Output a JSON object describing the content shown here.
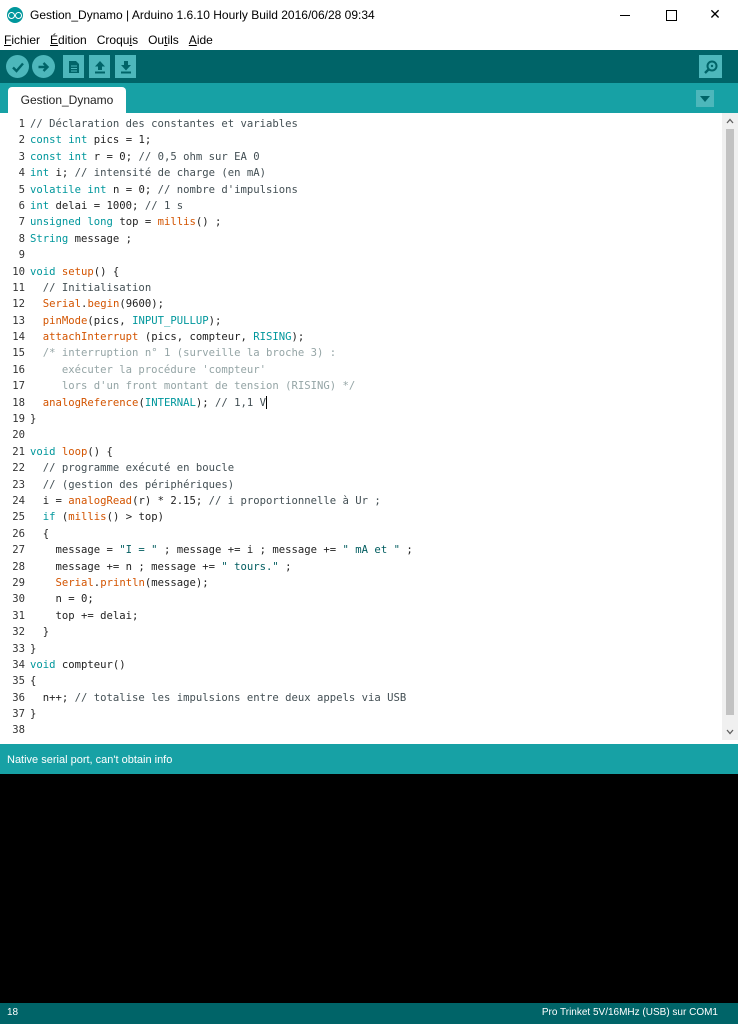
{
  "window": {
    "title": "Gestion_Dynamo | Arduino 1.6.10 Hourly Build 2016/06/28 09:34",
    "close_glyph": "✕"
  },
  "menu": {
    "items": [
      {
        "mnemonic": "F",
        "rest": "ichier"
      },
      {
        "mnemonic": "É",
        "rest": "dition"
      },
      {
        "prefix": "Croqu",
        "mnemonic": "i",
        "rest": "s"
      },
      {
        "prefix": "Ou",
        "mnemonic": "t",
        "rest": "ils"
      },
      {
        "mnemonic": "A",
        "rest": "ide"
      }
    ]
  },
  "toolbar": {
    "icons": [
      "verify-icon",
      "upload-icon",
      "new-sketch-icon",
      "open-sketch-icon",
      "save-sketch-icon",
      "serial-monitor-icon"
    ]
  },
  "tabs": [
    {
      "label": "Gestion_Dynamo"
    }
  ],
  "editor": {
    "line_numbers": [
      "1",
      "2",
      "3",
      "4",
      "5",
      "6",
      "7",
      "8",
      "9",
      "10",
      "11",
      "12",
      "13",
      "14",
      "15",
      "16",
      "17",
      "18",
      "19",
      "20",
      "21",
      "22",
      "23",
      "24",
      "25",
      "26",
      "27",
      "28",
      "29",
      "30",
      "31",
      "32",
      "33",
      "34",
      "35",
      "36",
      "37",
      "38"
    ],
    "lines": [
      [
        {
          "t": "// Déclaration des constantes et variables",
          "c": "cm"
        }
      ],
      [
        {
          "t": "const",
          "c": "kw"
        },
        {
          "t": " "
        },
        {
          "t": "int",
          "c": "kw"
        },
        {
          "t": " pics = 1;"
        }
      ],
      [
        {
          "t": "const",
          "c": "kw"
        },
        {
          "t": " "
        },
        {
          "t": "int",
          "c": "kw"
        },
        {
          "t": " r = 0; "
        },
        {
          "t": "// 0,5 ohm sur EA 0",
          "c": "cm"
        }
      ],
      [
        {
          "t": "int",
          "c": "kw"
        },
        {
          "t": " i; "
        },
        {
          "t": "// intensité de charge (en mA)",
          "c": "cm"
        }
      ],
      [
        {
          "t": "volatile",
          "c": "kw"
        },
        {
          "t": " "
        },
        {
          "t": "int",
          "c": "kw"
        },
        {
          "t": " n = 0; "
        },
        {
          "t": "// nombre d'impulsions",
          "c": "cm"
        }
      ],
      [
        {
          "t": "int",
          "c": "kw"
        },
        {
          "t": " delai = 1000; "
        },
        {
          "t": "// 1 s",
          "c": "cm"
        }
      ],
      [
        {
          "t": "unsigned",
          "c": "kw"
        },
        {
          "t": " "
        },
        {
          "t": "long",
          "c": "kw"
        },
        {
          "t": " top = "
        },
        {
          "t": "millis",
          "c": "fn"
        },
        {
          "t": "() ;"
        }
      ],
      [
        {
          "t": "String",
          "c": "kw"
        },
        {
          "t": " message ;"
        }
      ],
      [],
      [
        {
          "t": "void",
          "c": "kw"
        },
        {
          "t": " "
        },
        {
          "t": "setup",
          "c": "fn"
        },
        {
          "t": "() {"
        }
      ],
      [
        {
          "t": "  "
        },
        {
          "t": "// Initialisation",
          "c": "cm"
        }
      ],
      [
        {
          "t": "  "
        },
        {
          "t": "Serial",
          "c": "fn"
        },
        {
          "t": "."
        },
        {
          "t": "begin",
          "c": "fn"
        },
        {
          "t": "(9600);"
        }
      ],
      [
        {
          "t": "  "
        },
        {
          "t": "pinMode",
          "c": "fn"
        },
        {
          "t": "(pics, "
        },
        {
          "t": "INPUT_PULLUP",
          "c": "kw"
        },
        {
          "t": ");"
        }
      ],
      [
        {
          "t": "  "
        },
        {
          "t": "attachInterrupt",
          "c": "fn"
        },
        {
          "t": " (pics, compteur, "
        },
        {
          "t": "RISING",
          "c": "kw"
        },
        {
          "t": ");"
        }
      ],
      [
        {
          "t": "  "
        },
        {
          "t": "/* interruption n° 1 (surveille la broche 3) :",
          "c": "cmb"
        }
      ],
      [
        {
          "t": "     exécuter la procédure 'compteur'",
          "c": "cmb"
        }
      ],
      [
        {
          "t": "     lors d'un front montant de tension (RISING) */",
          "c": "cmb"
        }
      ],
      [
        {
          "t": "  "
        },
        {
          "t": "analogReference",
          "c": "fn"
        },
        {
          "t": "("
        },
        {
          "t": "INTERNAL",
          "c": "kw"
        },
        {
          "t": "); "
        },
        {
          "t": "// 1,1 V",
          "c": "cm"
        }
      ],
      [
        {
          "t": "}"
        }
      ],
      [],
      [
        {
          "t": "void",
          "c": "kw"
        },
        {
          "t": " "
        },
        {
          "t": "loop",
          "c": "fn"
        },
        {
          "t": "() {"
        }
      ],
      [
        {
          "t": "  "
        },
        {
          "t": "// programme exécuté en boucle",
          "c": "cm"
        }
      ],
      [
        {
          "t": "  "
        },
        {
          "t": "// (gestion des périphériques)",
          "c": "cm"
        }
      ],
      [
        {
          "t": "  i = "
        },
        {
          "t": "analogRead",
          "c": "fn"
        },
        {
          "t": "(r) * 2.15; "
        },
        {
          "t": "// i proportionnelle à Ur ;",
          "c": "cm"
        }
      ],
      [
        {
          "t": "  "
        },
        {
          "t": "if",
          "c": "kw"
        },
        {
          "t": " ("
        },
        {
          "t": "millis",
          "c": "fn"
        },
        {
          "t": "() > top)"
        }
      ],
      [
        {
          "t": "  {"
        }
      ],
      [
        {
          "t": "    message = "
        },
        {
          "t": "\"I = \"",
          "c": "st"
        },
        {
          "t": " ; message += i ; message += "
        },
        {
          "t": "\" mA et \"",
          "c": "st"
        },
        {
          "t": " ;"
        }
      ],
      [
        {
          "t": "    message += n ; message += "
        },
        {
          "t": "\" tours.\"",
          "c": "st"
        },
        {
          "t": " ;"
        }
      ],
      [
        {
          "t": "    "
        },
        {
          "t": "Serial",
          "c": "fn"
        },
        {
          "t": "."
        },
        {
          "t": "println",
          "c": "fn"
        },
        {
          "t": "(message);"
        }
      ],
      [
        {
          "t": "    n = 0;"
        }
      ],
      [
        {
          "t": "    top += delai;"
        }
      ],
      [
        {
          "t": "  }"
        }
      ],
      [
        {
          "t": "}"
        }
      ],
      [
        {
          "t": "void",
          "c": "kw"
        },
        {
          "t": " compteur()"
        }
      ],
      [
        {
          "t": "{"
        }
      ],
      [
        {
          "t": "  n++; "
        },
        {
          "t": "// totalise les impulsions entre deux appels via USB",
          "c": "cm"
        }
      ],
      [
        {
          "t": "}"
        }
      ],
      []
    ],
    "caret_line": 18
  },
  "status": {
    "message": "Native serial port, can't obtain info"
  },
  "footer": {
    "line_number": "18",
    "board": "Pro Trinket 5V/16MHz (USB) sur COM1"
  }
}
